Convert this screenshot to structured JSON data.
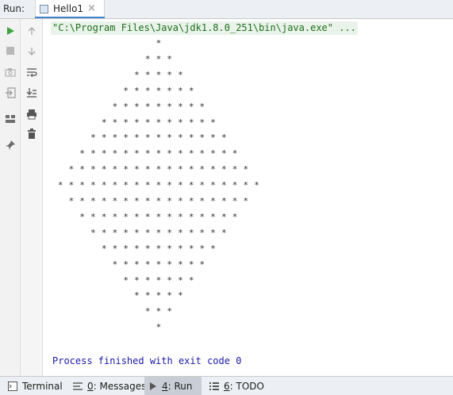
{
  "header": {
    "run_label": "Run:",
    "tab_label": "Hello1",
    "tab_close": "×"
  },
  "console": {
    "command": "\"C:\\Program Files\\Java\\jdk1.8.0_251\\bin\\java.exe\" ...",
    "output_lines": [
      "                   *",
      "                 * * *",
      "               * * * * *",
      "             * * * * * * *",
      "           * * * * * * * * *",
      "         * * * * * * * * * * *",
      "       * * * * * * * * * * * * *",
      "     * * * * * * * * * * * * * * *",
      "   * * * * * * * * * * * * * * * * *",
      " * * * * * * * * * * * * * * * * * * *",
      "   * * * * * * * * * * * * * * * * *",
      "     * * * * * * * * * * * * * * *",
      "       * * * * * * * * * * * * *",
      "         * * * * * * * * * * *",
      "           * * * * * * * * *",
      "             * * * * * * *",
      "               * * * * *",
      "                 * * *",
      "                   *"
    ],
    "finish_message": "Process finished with exit code 0"
  },
  "bottom_bar": {
    "terminal": "Terminal",
    "messages_num": "0",
    "messages_rest": ": Messages",
    "run_num": "4",
    "run_rest": ": Run",
    "todo_num": "6",
    "todo_rest": ": TODO"
  },
  "colors": {
    "command_bg": "#e9f3e9",
    "command_text": "#1e6e1e",
    "finish_text": "#1a1aa6",
    "run_icon": "#3fa33f",
    "active_tab_accent": "#4083c9"
  }
}
